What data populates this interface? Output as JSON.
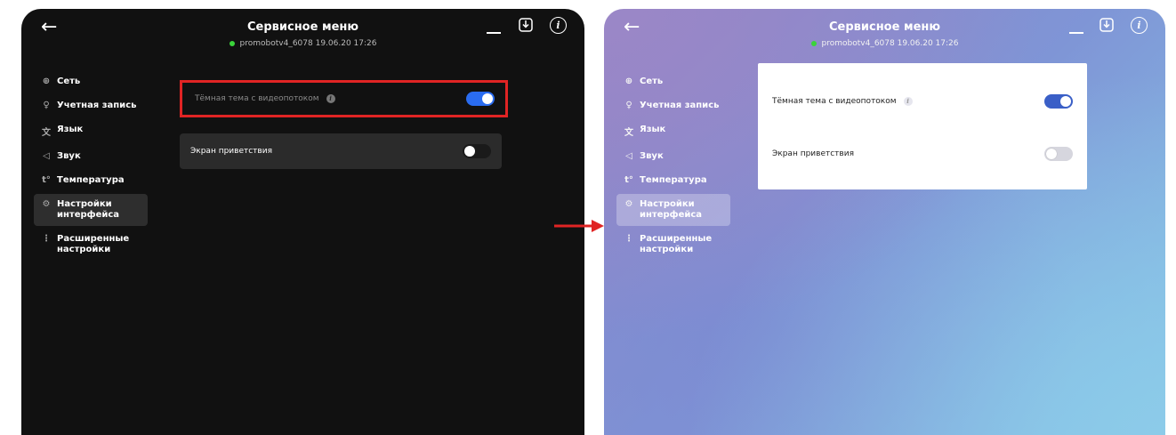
{
  "screens": [
    {
      "theme": "dark",
      "header": {
        "title": "Сервисное меню",
        "subtitle": "promobotv4_6078 19.06.20 17:26",
        "back_icon": "←",
        "info_icon": "i"
      },
      "sidebar": {
        "items": [
          {
            "icon": "⊕",
            "label": "Сеть"
          },
          {
            "icon": "♀",
            "label": "Учетная запись"
          },
          {
            "icon": "文",
            "label": "Язык"
          },
          {
            "icon": "◁",
            "label": "Звук"
          },
          {
            "icon": "t°",
            "label": "Температура"
          },
          {
            "icon": "⚙",
            "label": "Настройки\nинтерфейса",
            "active": true
          },
          {
            "icon": "⋮",
            "label": "Расширенные\nнастройки"
          }
        ]
      },
      "settings": [
        {
          "label": "Тёмная тема с видеопотоком",
          "has_info": true,
          "info_icon": "i",
          "on": true
        },
        {
          "label": "Экран приветствия",
          "has_info": false,
          "on": false
        }
      ]
    },
    {
      "theme": "light",
      "header": {
        "title": "Сервисное меню",
        "subtitle": "promobotv4_6078 19.06.20 17:26",
        "back_icon": "←",
        "info_icon": "i"
      },
      "sidebar": {
        "items": [
          {
            "icon": "⊕",
            "label": "Сеть"
          },
          {
            "icon": "♀",
            "label": "Учетная запись"
          },
          {
            "icon": "文",
            "label": "Язык"
          },
          {
            "icon": "◁",
            "label": "Звук"
          },
          {
            "icon": "t°",
            "label": "Температура"
          },
          {
            "icon": "⚙",
            "label": "Настройки\nинтерфейса",
            "active": true
          },
          {
            "icon": "⋮",
            "label": "Расширенные\nнастройки"
          }
        ]
      },
      "settings": [
        {
          "label": "Тёмная тема с видеопотоком",
          "has_info": true,
          "info_icon": "i",
          "on": true
        },
        {
          "label": "Экран приветствия",
          "has_info": false,
          "on": false
        }
      ]
    }
  ],
  "colors": {
    "highlight_frame": "#e02424",
    "toggle_on_dark": "#2a6cf0",
    "toggle_on_light": "#3a5fc7",
    "status_online": "#3ad43a",
    "arrow": "#e02424"
  }
}
